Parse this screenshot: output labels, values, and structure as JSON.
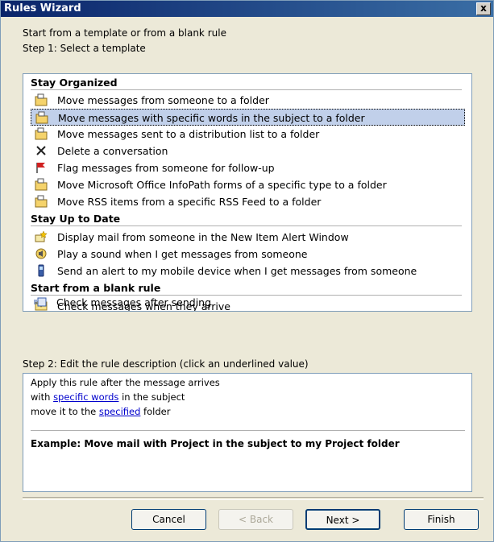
{
  "window": {
    "title": "Rules Wizard",
    "close_label": "x"
  },
  "intro_label": "Start from a template or from a blank rule",
  "step1_label": "Step 1: Select a template",
  "groups": [
    {
      "title": "Stay Organized",
      "items": [
        {
          "label": "Move messages from someone to a folder",
          "icon": "folder-move-icon"
        },
        {
          "label": "Move messages with specific words in the subject to a folder",
          "icon": "folder-move-icon",
          "selected": true
        },
        {
          "label": "Move messages sent to a distribution list to a folder",
          "icon": "folder-move-icon"
        },
        {
          "label": "Delete a conversation",
          "icon": "delete-x-icon"
        },
        {
          "label": "Flag messages from someone for follow-up",
          "icon": "flag-icon"
        },
        {
          "label": "Move Microsoft Office InfoPath forms of a specific type to a folder",
          "icon": "folder-move-icon"
        },
        {
          "label": "Move RSS items from a specific RSS Feed to a folder",
          "icon": "folder-move-icon"
        }
      ]
    },
    {
      "title": "Stay Up to Date",
      "items": [
        {
          "label": "Display mail from someone in the New Item Alert Window",
          "icon": "alert-star-icon"
        },
        {
          "label": "Play a sound when I get messages from someone",
          "icon": "speaker-icon"
        },
        {
          "label": "Send an alert to my mobile device when I get messages from someone",
          "icon": "mobile-phone-icon"
        }
      ]
    },
    {
      "title": "Start from a blank rule",
      "items": [
        {
          "label": "Check messages when they arrive",
          "icon": "envelope-icon"
        },
        {
          "label": "Check messages after sending",
          "icon": "send-mail-icon"
        }
      ]
    }
  ],
  "step2_label": "Step 2: Edit the rule description (click an underlined value)",
  "description": {
    "line1": "Apply this rule after the message arrives",
    "line2_pre": "with ",
    "line2_link": "specific words",
    "line2_post": " in the subject",
    "line3_pre": "move it to the ",
    "line3_link": "specified",
    "line3_post": " folder",
    "example": "Example: Move mail with Project in the subject to my Project folder"
  },
  "buttons": {
    "cancel": "Cancel",
    "back": "< Back",
    "next": "Next >",
    "finish": "Finish"
  },
  "colors": {
    "titlebar": "#0a246a",
    "selection": "#c1d0ea",
    "link": "#0000cc",
    "border": "#7f9db9"
  }
}
